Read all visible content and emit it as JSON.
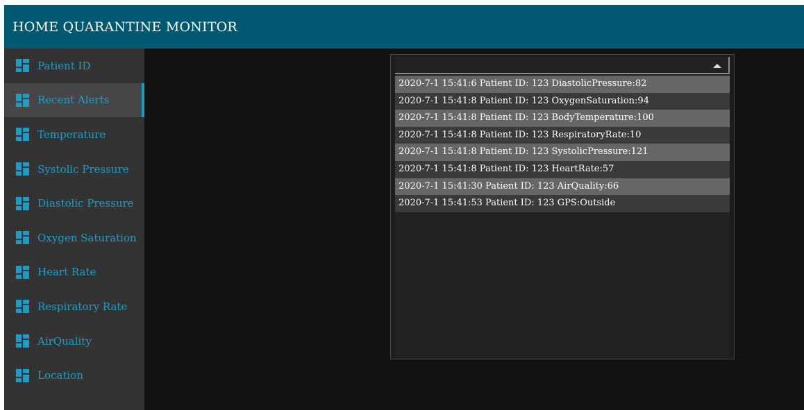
{
  "header": {
    "title": "HOME QUARANTINE MONITOR"
  },
  "sidebar": {
    "items": [
      {
        "label": "Patient ID"
      },
      {
        "label": "Recent Alerts"
      },
      {
        "label": "Temperature"
      },
      {
        "label": "Systolic Pressure"
      },
      {
        "label": "Diastolic Pressure"
      },
      {
        "label": "Oxygen Saturation"
      },
      {
        "label": "Heart Rate"
      },
      {
        "label": "Respiratory Rate"
      },
      {
        "label": "AirQuality"
      },
      {
        "label": "Location"
      }
    ],
    "active": "Recent Alerts"
  },
  "alerts": {
    "items": [
      "2020-7-1 15:41:6 Patient ID: 123 DiastolicPressure:82",
      "2020-7-1 15:41:8 Patient ID: 123 OxygenSaturation:94",
      "2020-7-1 15:41:8 Patient ID: 123 BodyTemperature:100",
      "2020-7-1 15:41:8 Patient ID: 123 RespiratoryRate:10",
      "2020-7-1 15:41:8 Patient ID: 123 SystolicPressure:121",
      "2020-7-1 15:41:8 Patient ID: 123 HeartRate:57",
      "2020-7-1 15:41:30 Patient ID: 123 AirQuality:66",
      "2020-7-1 15:41:53 Patient ID: 123 GPS:Outside"
    ]
  },
  "colors": {
    "header": "#005871",
    "accent": "#1a9ec9",
    "sidebar": "#333333",
    "background": "#121212"
  },
  "icons": {
    "nav": "dashboard-tiles-icon",
    "dropdown": "caret-up-icon"
  }
}
